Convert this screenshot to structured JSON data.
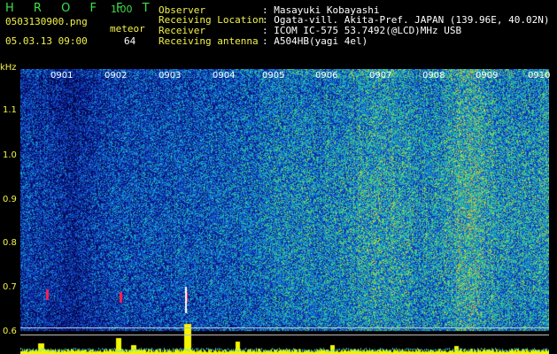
{
  "app": {
    "brand": "H R O F F T",
    "version": "1.00",
    "filename": "0503130900.png",
    "timestamp": "05.03.13 09:00",
    "meteor_label": "meteor",
    "meteor_count": "64"
  },
  "info": {
    "observer_label": "Observer",
    "observer_value": ": Masayuki Kobayashi",
    "location_label": "Receiving Location",
    "location_value": ": Ogata-vill. Akita-Pref. JAPAN (139.96E, 40.02N)",
    "receiver_label": "Receiver",
    "receiver_value": ": ICOM IC-575 53.7492(@LCD)MHz USB",
    "antenna_label": "Receiving antenna",
    "antenna_value": ": A504HB(yagi 4el)"
  },
  "axes": {
    "unit": "kHz",
    "y_ticks": [
      "1.1",
      "1.0",
      "0.9",
      "0.8",
      "0.7",
      "0.6"
    ],
    "x_ticks": [
      "0901",
      "0902",
      "0903",
      "0904",
      "0905",
      "0906",
      "0907",
      "0908",
      "0909",
      "0910"
    ]
  },
  "colors": {
    "brand": "#3ee04a",
    "header_yellow": "#f2f24a",
    "header_white": "#ffffff",
    "meteor_bar": "#f5f500",
    "echo_red": "#ff2050",
    "background_spectrum": "#0a1a8a"
  }
}
